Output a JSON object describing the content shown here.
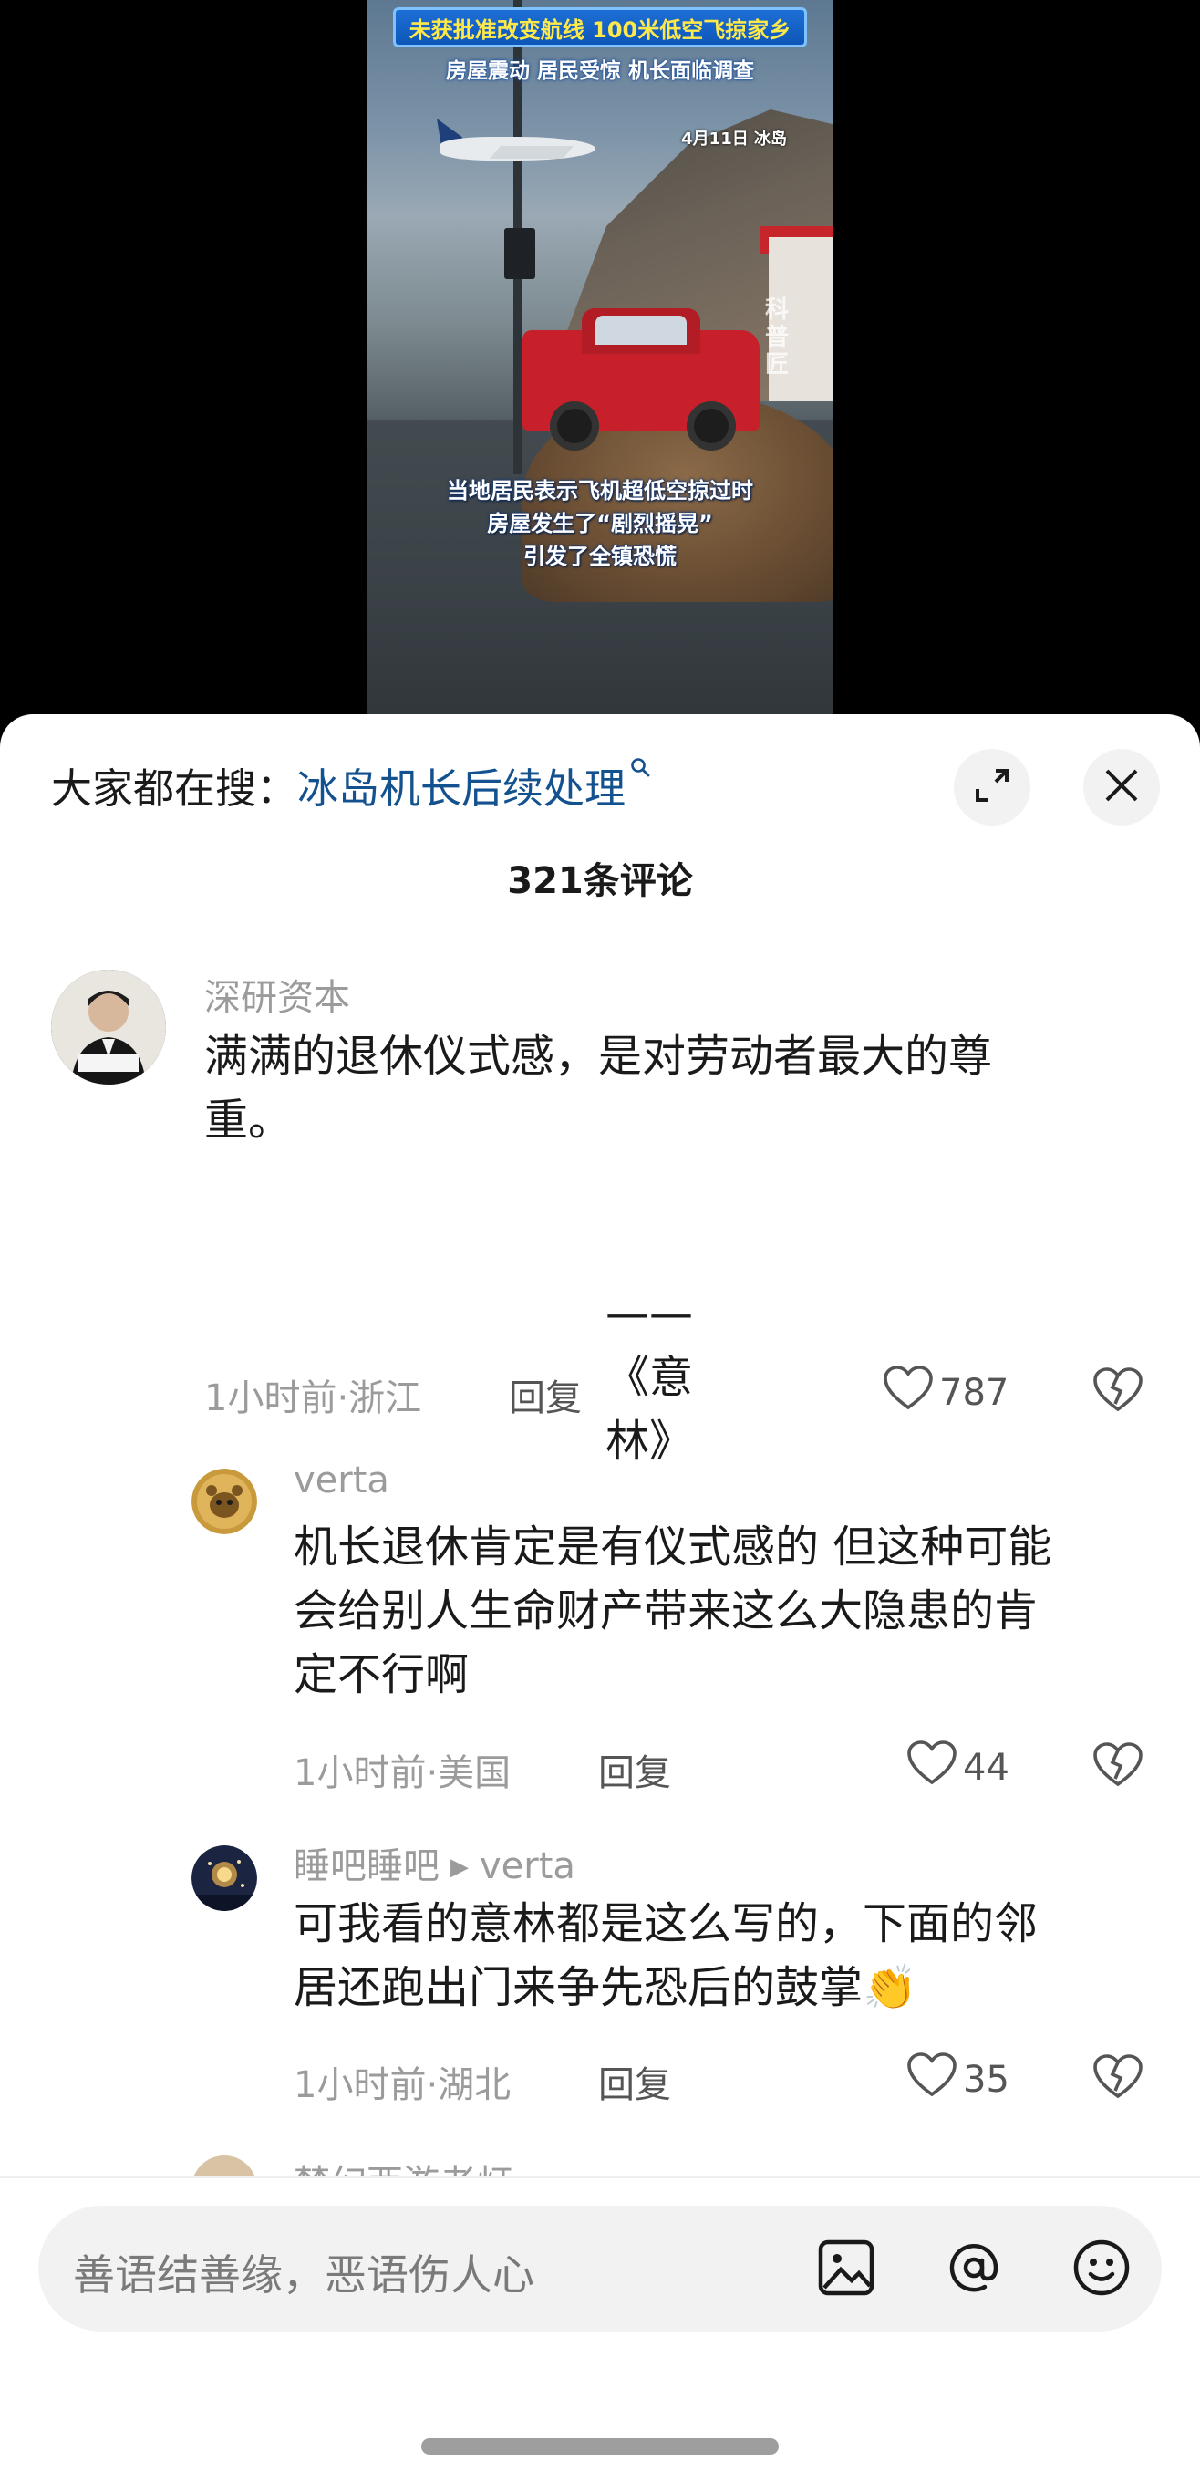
{
  "video": {
    "headline": "未获批准改变航线 100米低空飞掠家乡",
    "subhead": "房屋震动 居民受惊 机长面临调查",
    "date": "4月11日 冰岛",
    "watermark": "科普匠",
    "caption_lines": [
      "当地居民表示飞机超低空掠过时",
      "房屋发生了“剧烈摇晃”",
      "引发了全镇恐慌"
    ]
  },
  "search": {
    "prefix": "大家都在搜：",
    "term": "冰岛机长后续处理",
    "icon": "search-icon"
  },
  "header": {
    "comment_count": "321条评论",
    "expand_icon": "expand-icon",
    "close_icon": "close-icon"
  },
  "comments": [
    {
      "username": "深研资本",
      "text_line1": "满满的退休仪式感，是对劳动者最大的尊",
      "text_line2": "重。",
      "quote": "——《意林》",
      "time_location": "1小时前·浙江",
      "reply_label": "回复",
      "likes": "787"
    },
    {
      "username": "verta",
      "text_line1": "机长退休肯定是有仪式感的 但这种可能",
      "text_line2": "会给别人生命财产带来这么大隐患的肯",
      "text_line3": "定不行啊",
      "time_location": "1小时前·美国",
      "reply_label": "回复",
      "likes": "44"
    },
    {
      "username": "睡吧睡吧",
      "reply_to": "verta",
      "text_line1": "可我看的意林都是这么写的，下面的邻",
      "text_line2": "居还跑出门来争先恐后的鼓掌",
      "emoji": "👏",
      "time_location": "1小时前·湖北",
      "reply_label": "回复",
      "likes": "35"
    },
    {
      "username": "梦幻西游老灯"
    }
  ],
  "input": {
    "placeholder": "善语结善缘，恶语伤人心",
    "image_icon": "image-icon",
    "mention_icon": "at-icon",
    "emoji_icon": "emoji-icon"
  }
}
